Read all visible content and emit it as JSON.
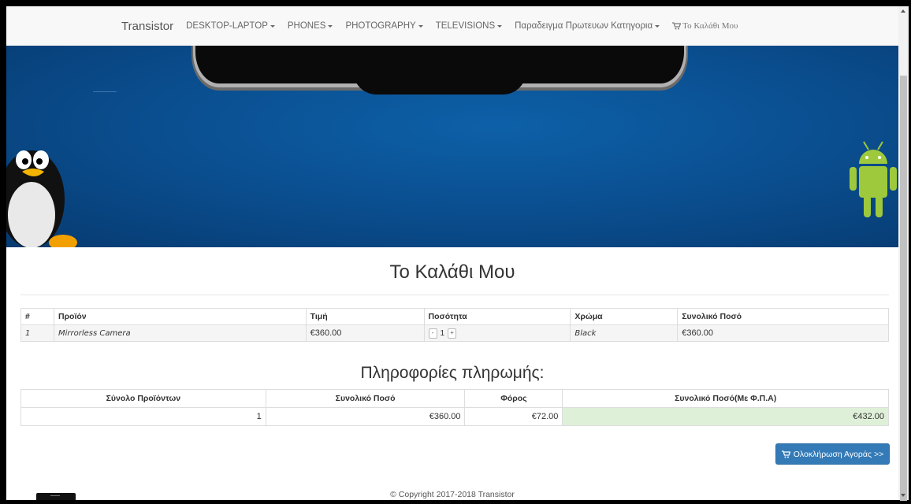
{
  "navbar": {
    "brand": "Transistor",
    "items": [
      {
        "label": "DESKTOP-LAPTOP"
      },
      {
        "label": "PHONES"
      },
      {
        "label": "PHOTOGRAPHY"
      },
      {
        "label": "TELEVISIONS"
      },
      {
        "label": "Παραδειγμα Πρωτευων Κατηγορια"
      }
    ],
    "cart_label": "Το Καλάθι Μου",
    "cart_icon": "shopping-cart-icon"
  },
  "page": {
    "title": "Το Καλάθι Μου"
  },
  "cart_table": {
    "headers": [
      "#",
      "Προϊόν",
      "Τιμή",
      "Ποσότητα",
      "Χρώμα",
      "Συνολικό Ποσό"
    ],
    "rows": [
      {
        "index": "1",
        "product": "Mirrorless Camera",
        "price": "€360.00",
        "qty_minus": "-",
        "quantity": "1",
        "qty_plus": "+",
        "color": "Black",
        "total": "€360.00"
      }
    ]
  },
  "payment": {
    "title": "Πληροφορίες πληρωμής:",
    "headers": [
      "Σύνολο Προϊόντων",
      "Συνολικό Ποσό",
      "Φόρος",
      "Συνολικό Ποσό(Με Φ.Π.Α)"
    ],
    "values": [
      "1",
      "€360.00",
      "€72.00",
      "€432.00"
    ],
    "highlight_color": "#dff0d8"
  },
  "checkout_button": {
    "label": "Ολοκλήρωση Αγοράς >>",
    "icon": "shopping-cart-icon",
    "color": "#337ab7"
  },
  "footer": {
    "copyright": "© Copyright 2017-2018 Transistor"
  }
}
